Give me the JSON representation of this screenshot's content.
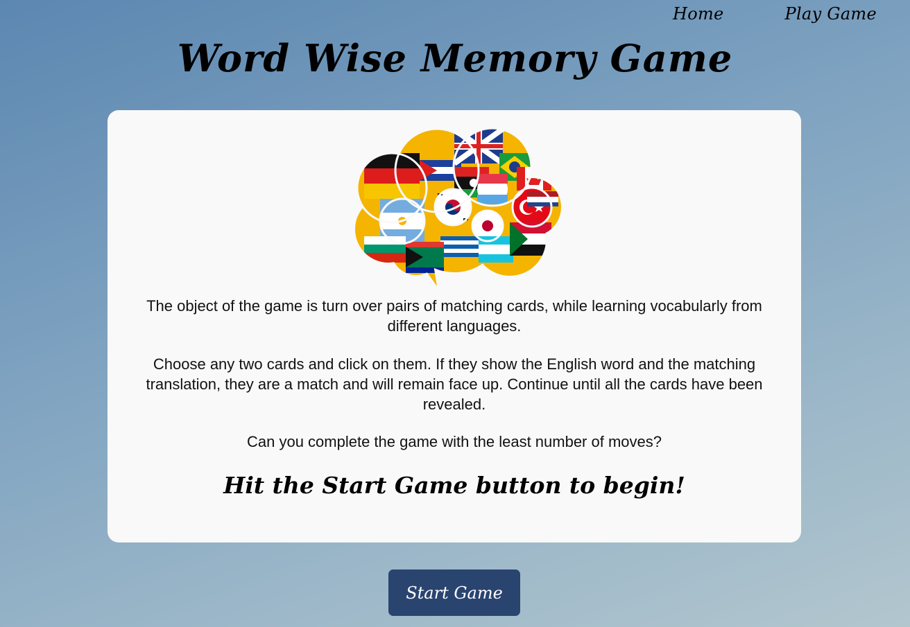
{
  "nav": {
    "home_label": "Home",
    "play_label": "Play Game"
  },
  "page": {
    "title": "Word Wise Memory Game"
  },
  "intro": {
    "image_icon": "flags-speech-cloud-icon",
    "paragraph1": "The object of the game is turn over pairs of matching cards, while learning vocabularly from different languages.",
    "paragraph2": "Choose any two cards and click on them. If they show the English word and the matching translation, they are a match and will remain face up. Continue until all the cards have been revealed.",
    "paragraph3": "Can you complete the game with the least number of moves?",
    "call_to_action": "Hit the Start Game button to begin!"
  },
  "actions": {
    "start_label": "Start Game"
  },
  "colors": {
    "button_bg": "#2a4470",
    "card_bg": "#f9f9f9"
  }
}
